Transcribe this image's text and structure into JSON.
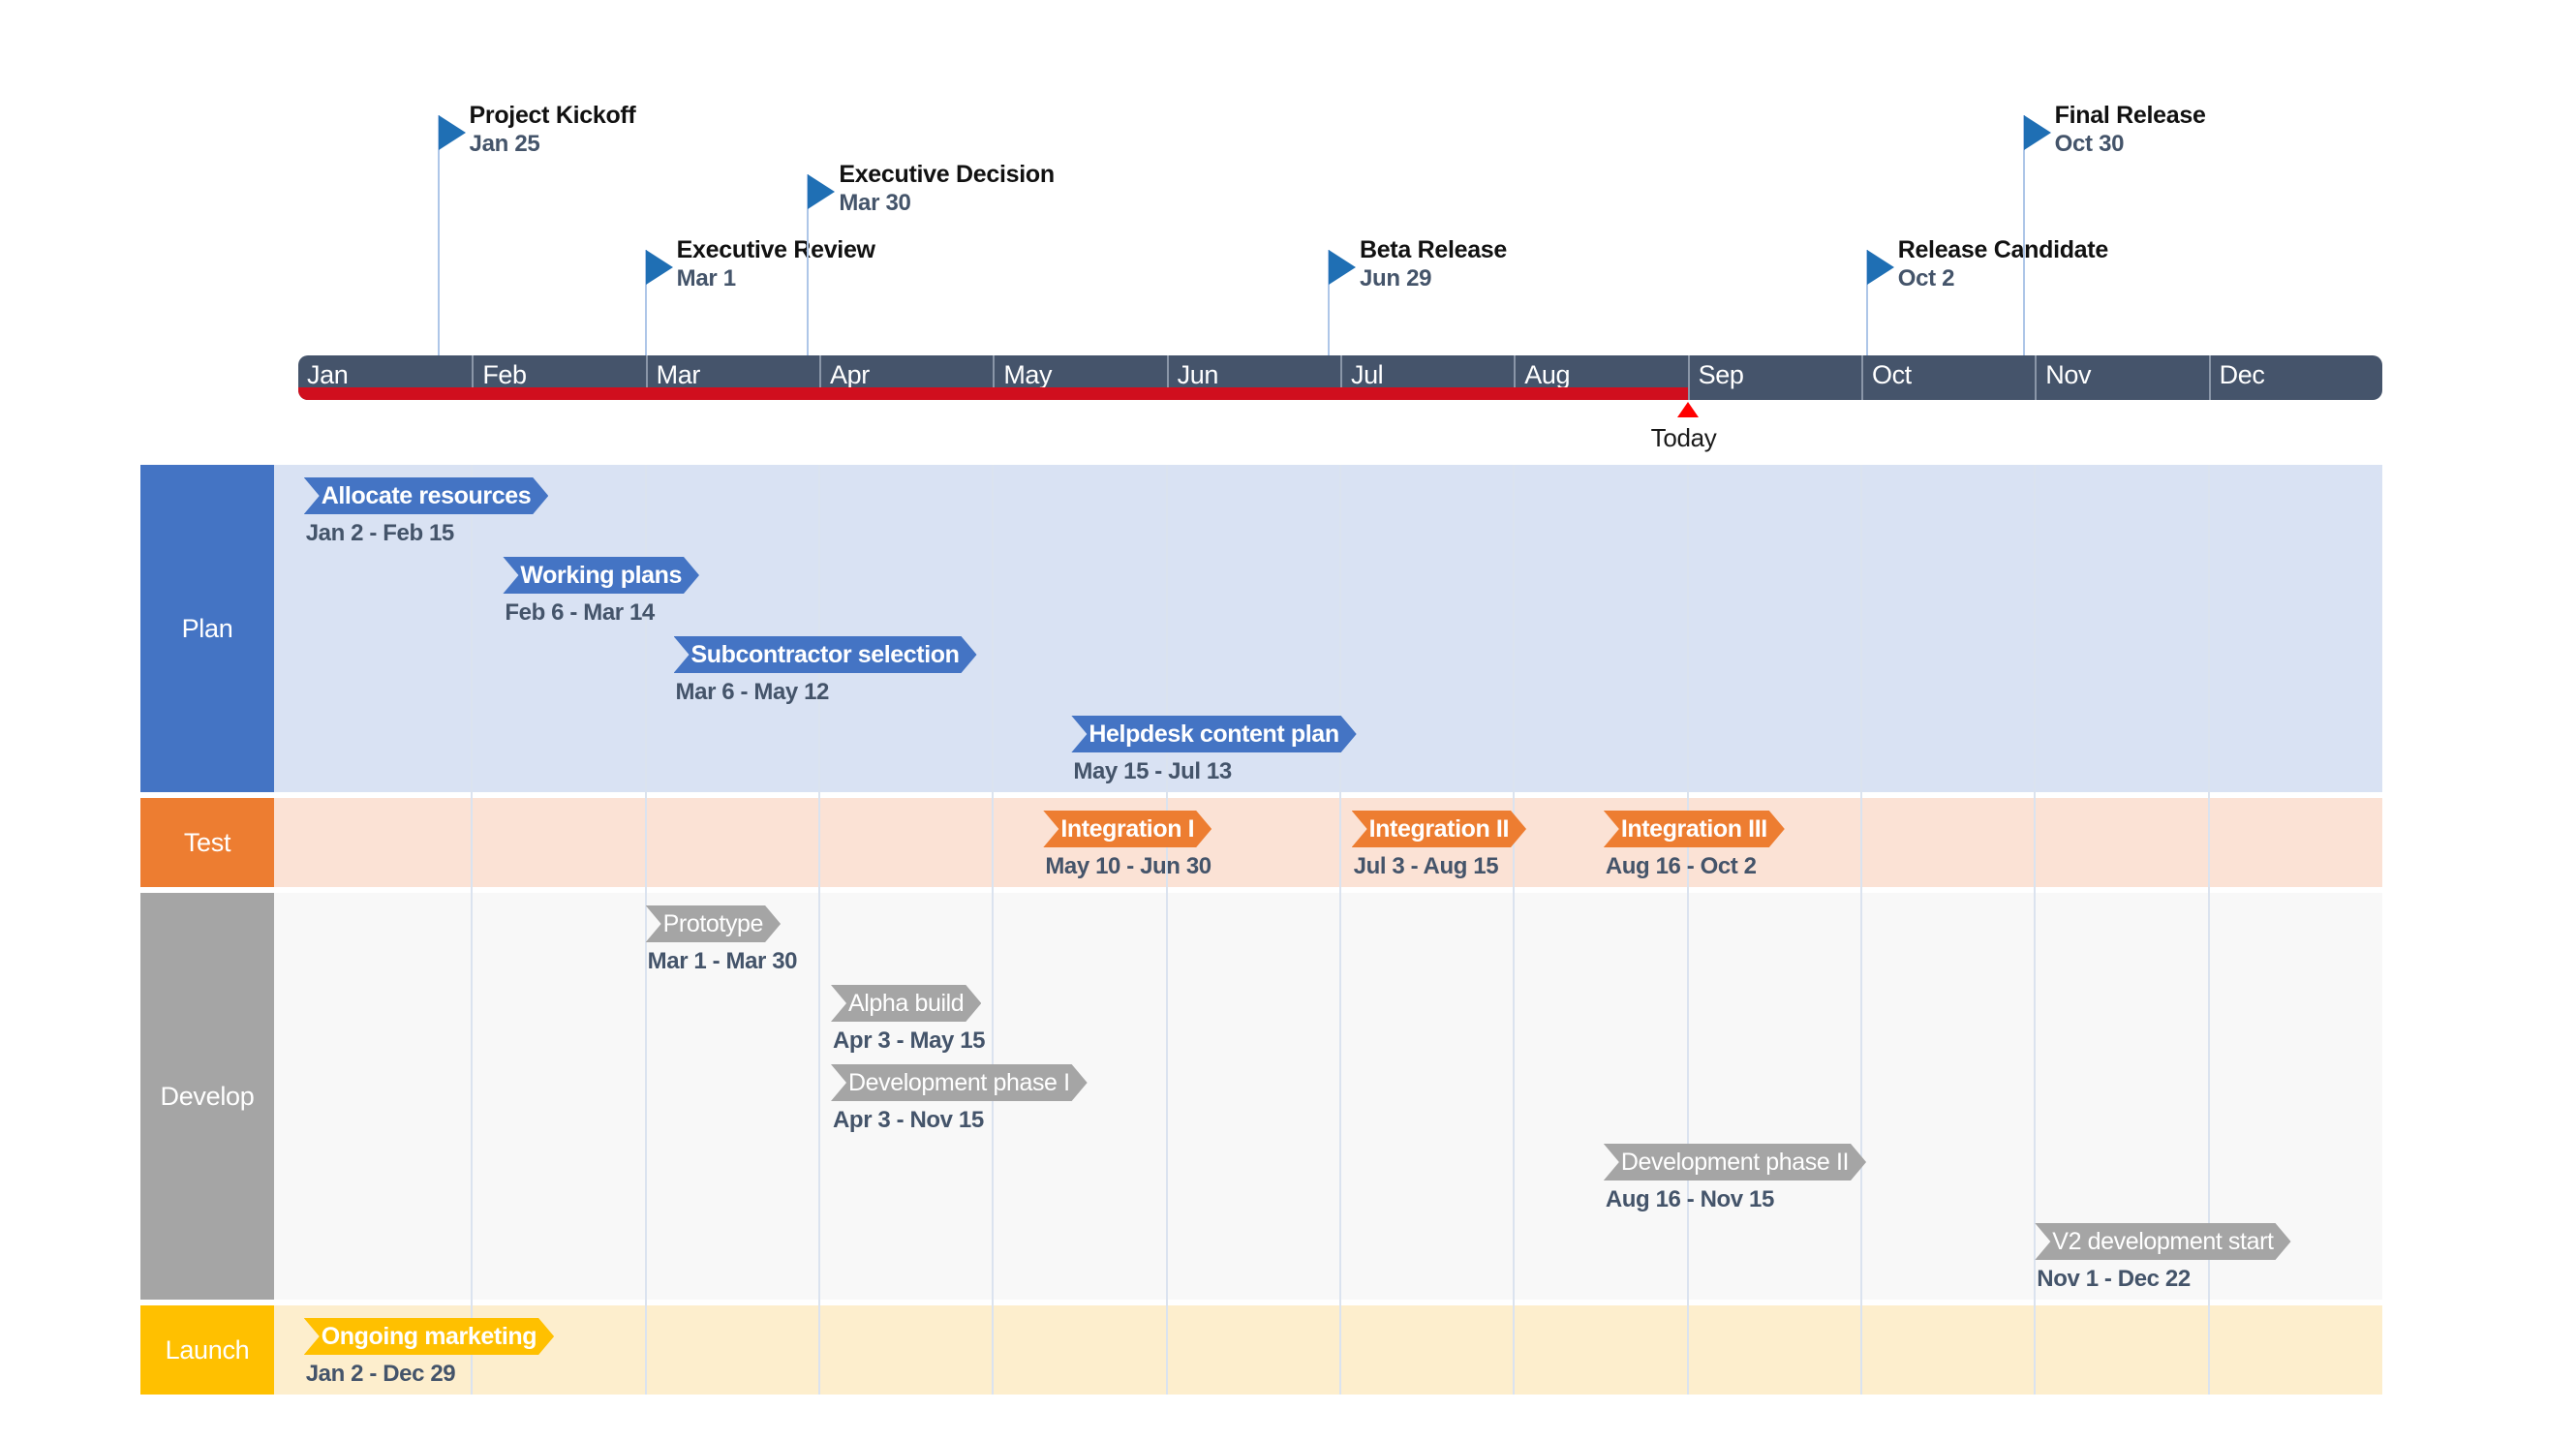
{
  "chart_data": {
    "type": "gantt",
    "title": "",
    "timeline": {
      "months": [
        "Jan",
        "Feb",
        "Mar",
        "Apr",
        "May",
        "Jun",
        "Jul",
        "Aug",
        "Sep",
        "Oct",
        "Nov",
        "Dec"
      ],
      "today_label": "Today",
      "today_month_fraction": 8.0,
      "progress_color": "#d00f1e",
      "header_color": "#45546b"
    },
    "milestones": [
      {
        "name": "Project Kickoff",
        "date": "Jan 25",
        "pos": 0.806,
        "row": 0
      },
      {
        "name": "Executive Review",
        "date": "Mar 1",
        "pos": 2.0,
        "row": 1
      },
      {
        "name": "Executive Decision",
        "date": "Mar 30",
        "pos": 2.935,
        "row": 2
      },
      {
        "name": "Beta Release",
        "date": "Jun 29",
        "pos": 5.933,
        "row": 1
      },
      {
        "name": "Release Candidate",
        "date": "Oct 2",
        "pos": 9.032,
        "row": 1
      },
      {
        "name": "Final Release",
        "date": "Oct 30",
        "pos": 9.935,
        "row": 0
      }
    ],
    "lanes": [
      {
        "label": "Plan",
        "color": "#4474c4",
        "body_color": "#d9e2f3",
        "rows": 4,
        "tasks": [
          {
            "name": "Allocate resources",
            "dates": "Jan 2 - Feb 15",
            "start": 0.032,
            "end": 1.5,
            "row": 0
          },
          {
            "name": "Working plans",
            "dates": "Feb 6 - Mar 14",
            "start": 1.179,
            "end": 2.419,
            "row": 1
          },
          {
            "name": "Subcontractor selection",
            "dates": "Mar 6 - May 12",
            "start": 2.161,
            "end": 4.355,
            "row": 2
          },
          {
            "name": "Helpdesk content plan",
            "dates": "May 15 - Jul 13",
            "start": 4.452,
            "end": 6.387,
            "row": 3
          }
        ]
      },
      {
        "label": "Test",
        "color": "#ed7d31",
        "body_color": "#fbe2d5",
        "rows": 1,
        "tasks": [
          {
            "name": "Integration I",
            "dates": "May 10 - Jun 30",
            "start": 4.29,
            "end": 5.967,
            "row": 0
          },
          {
            "name": "Integration II",
            "dates": "Jul 3 - Aug 15",
            "start": 6.065,
            "end": 7.484,
            "row": 0
          },
          {
            "name": "Integration III",
            "dates": "Aug 16 - Oct 2",
            "start": 7.516,
            "end": 9.032,
            "row": 0
          }
        ]
      },
      {
        "label": "Develop",
        "color": "#a5a5a5",
        "body_color": "#f8f8f8",
        "rows": 5,
        "tasks": [
          {
            "name": "Prototype",
            "dates": "Mar 1 - Mar 30",
            "start": 2.0,
            "end": 2.935,
            "row": 0
          },
          {
            "name": "Alpha build",
            "dates": "Apr 3 - May 15",
            "start": 3.067,
            "end": 4.452,
            "row": 1
          },
          {
            "name": "Development phase I",
            "dates": "Apr 3 - Nov 15",
            "start": 3.067,
            "end": 11.467,
            "row": 2
          },
          {
            "name": "Development phase II",
            "dates": "Aug 16 - Nov 15",
            "start": 7.516,
            "end": 11.467,
            "row": 3
          },
          {
            "name": "V2 development start",
            "dates": "Nov 1 - Dec 22",
            "start": 10.0,
            "end": 12.71,
            "row": 4
          }
        ]
      },
      {
        "label": "Launch",
        "color": "#ffc000",
        "body_color": "#fdeecd",
        "rows": 1,
        "tasks": [
          {
            "name": "Ongoing marketing",
            "dates": "Jan 2 - Dec 29",
            "start": 0.032,
            "end": 12.935,
            "row": 0
          }
        ]
      }
    ]
  }
}
